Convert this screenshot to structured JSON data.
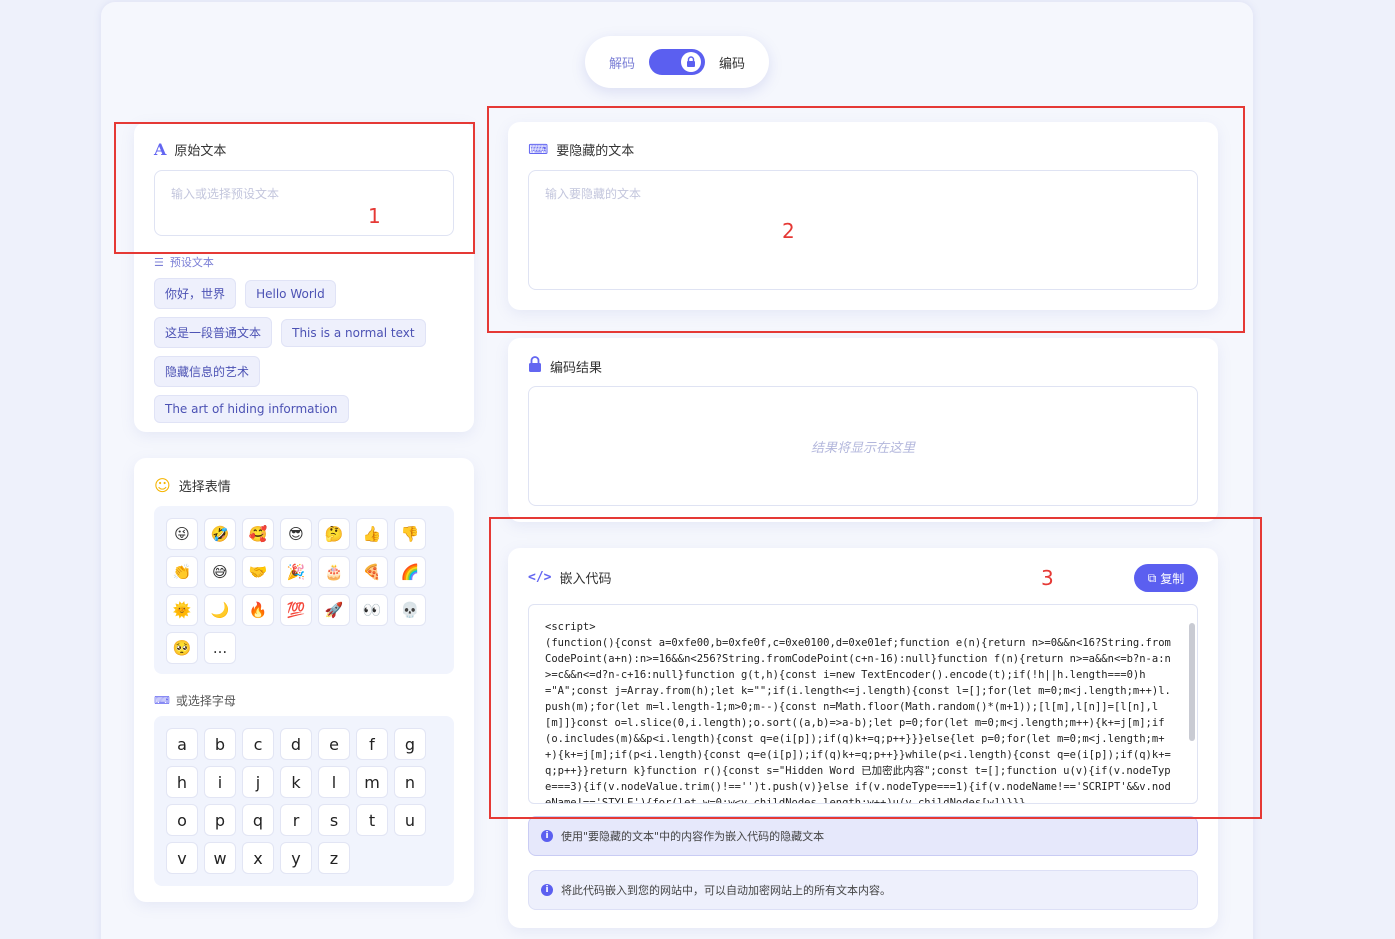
{
  "mode_toggle": {
    "decode_label": "解码",
    "encode_label": "编码"
  },
  "original_text": {
    "title": "原始文本",
    "placeholder": "输入或选择预设文本",
    "preset_label": "预设文本",
    "presets": [
      "你好，世界",
      "Hello World",
      "这是一段普通文本",
      "This is a normal text",
      "隐藏信息的艺术",
      "The art of hiding information"
    ]
  },
  "emoji_picker": {
    "title": "选择表情",
    "emojis": [
      "😜",
      "🤣",
      "🥰",
      "😎",
      "🤔",
      "👍",
      "👎",
      "👏",
      "😅",
      "🤝",
      "🎉",
      "🎂",
      "🍕",
      "🌈",
      "🌞",
      "🌙",
      "🔥",
      "💯",
      "🚀",
      "👀",
      "💀",
      "🥺",
      "..."
    ],
    "letters_label": "或选择字母",
    "letters": [
      "a",
      "b",
      "c",
      "d",
      "e",
      "f",
      "g",
      "h",
      "i",
      "j",
      "k",
      "l",
      "m",
      "n",
      "o",
      "p",
      "q",
      "r",
      "s",
      "t",
      "u",
      "v",
      "w",
      "x",
      "y",
      "z"
    ]
  },
  "hidden_text": {
    "title": "要隐藏的文本",
    "placeholder": "输入要隐藏的文本"
  },
  "encode_result": {
    "title": "编码结果",
    "placeholder": "结果将显示在这里"
  },
  "embed_code": {
    "title": "嵌入代码",
    "copy_label": "复制",
    "code": "<script>\n(function(){const a=0xfe00,b=0xfe0f,c=0xe0100,d=0xe01ef;function e(n){return n>=0&&n<16?String.fromCodePoint(a+n):n>=16&&n<256?String.fromCodePoint(c+n-16):null}function f(n){return n>=a&&n<=b?n-a:n>=c&&n<=d?n-c+16:null}function g(t,h){const i=new TextEncoder().encode(t);if(!h||h.length===0)h=\"A\";const j=Array.from(h);let k=\"\";if(i.length<=j.length){const l=[];for(let m=0;m<j.length;m++)l.push(m);for(let m=l.length-1;m>0;m--){const n=Math.floor(Math.random()*(m+1));[l[m],l[n]]=[l[n],l[m]]}const o=l.slice(0,i.length);o.sort((a,b)=>a-b);let p=0;for(let m=0;m<j.length;m++){k+=j[m];if(o.includes(m)&&p<i.length){const q=e(i[p]);if(q)k+=q;p++}}}else{let p=0;for(let m=0;m<j.length;m++){k+=j[m];if(p<i.length){const q=e(i[p]);if(q)k+=q;p++}}while(p<i.length){const q=e(i[p]);if(q)k+=q;p++}}return k}function r(){const s=\"Hidden Word 已加密此内容\";const t=[];function u(v){if(v.nodeType===3){if(v.nodeValue.trim()!=='')t.push(v)}else if(v.nodeType===1){if(v.nodeName!=='SCRIPT'&&v.nodeName!=='STYLE'){for(let w=0;w<v.childNodes.length;w++)u(v.childNodes[w])}}}",
    "info1": "使用\"要隐藏的文本\"中的内容作为嵌入代码的隐藏文本",
    "info2": "将此代码嵌入到您的网站中，可以自动加密网站上的所有文本内容。"
  },
  "annotations": {
    "n1": "1",
    "n2": "2",
    "n3": "3"
  }
}
